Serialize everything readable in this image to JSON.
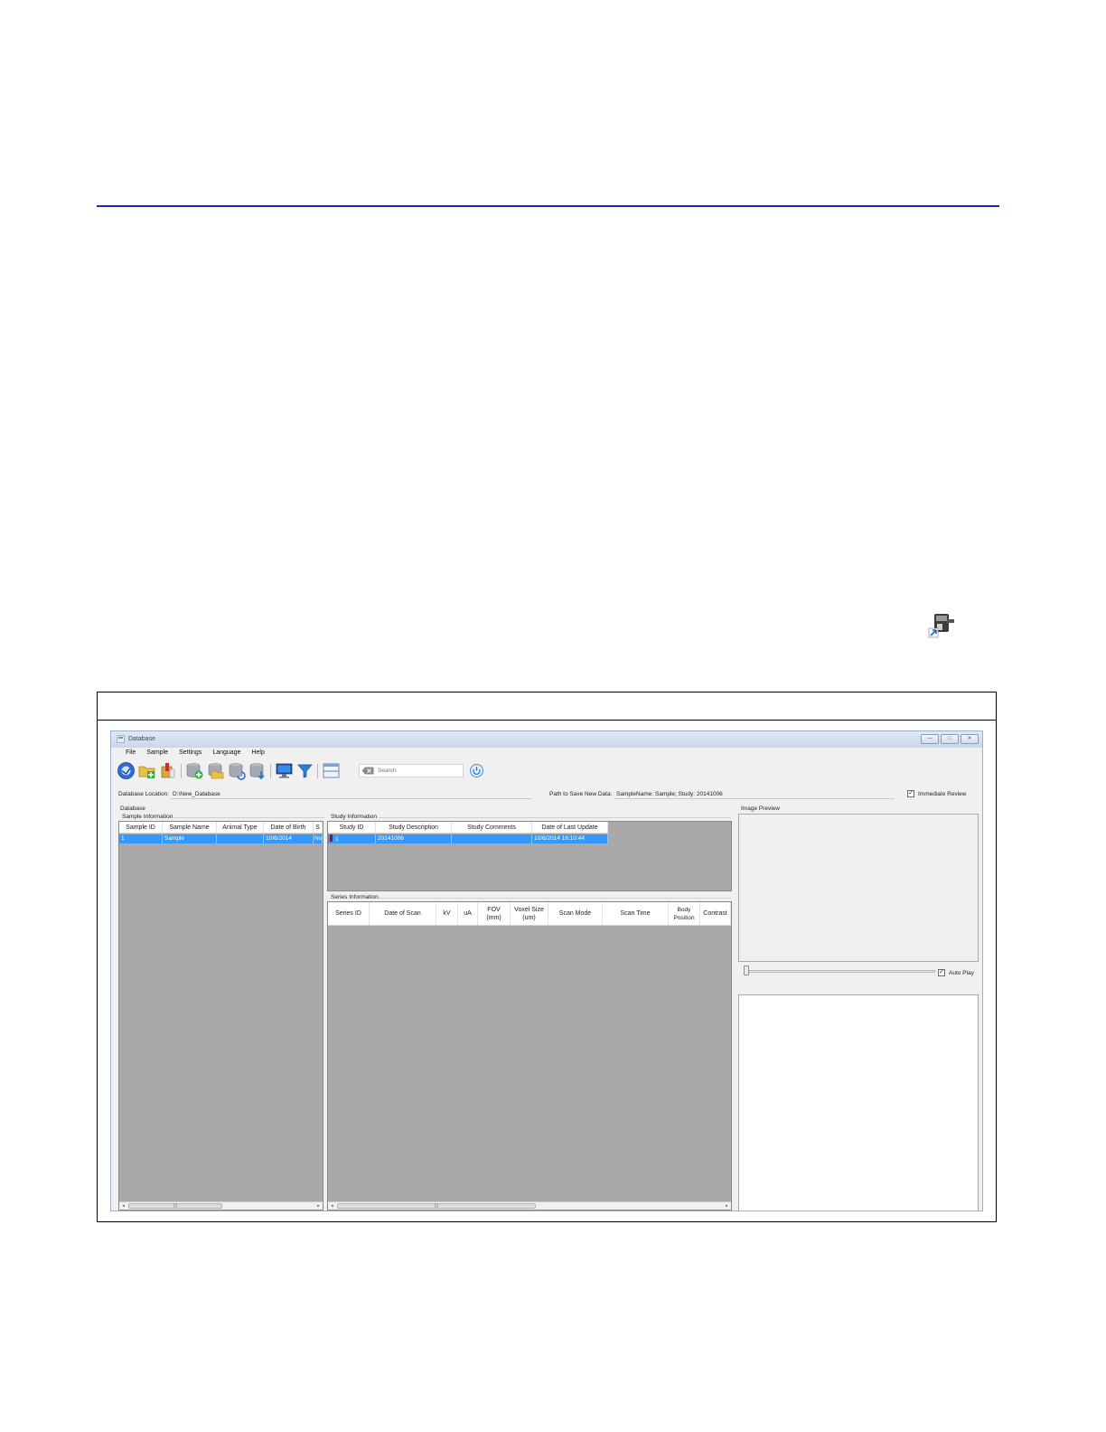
{
  "window": {
    "title": "Database",
    "minimize": "—",
    "maximize": "□",
    "close": "✕"
  },
  "menu": [
    "File",
    "Sample",
    "Settings",
    "Language",
    "Help"
  ],
  "toolbar": {
    "search_placeholder": "Search"
  },
  "location": {
    "db_label": "Database Location:",
    "db_value": "D:\\New_Database",
    "path_label": "Path to Save New Data:",
    "path_value": "SampleName: Sample; Study: 20141006",
    "immediate_review_label": "Immediate Review",
    "immediate_review_checked": true
  },
  "database_group": "Database",
  "sample": {
    "group": "Sample Information",
    "columns": [
      "Sample ID",
      "Sample Name",
      "Animal Type",
      "Date of Birth",
      "S"
    ],
    "rows": [
      [
        "1",
        "Sample",
        "",
        "10/6/2014",
        "No"
      ]
    ]
  },
  "study": {
    "group": "Study Information",
    "columns": [
      "Study ID",
      "Study Description",
      "Study Comments",
      "Date of Last Update"
    ],
    "rows": [
      [
        "1",
        "20141006",
        "",
        "10/6/2014 16:10:44"
      ]
    ]
  },
  "series": {
    "group": "Series Information",
    "columns": [
      "Series ID",
      "Date of Scan",
      "kV",
      "uA",
      "FOV\n(mm)",
      "Voxel Size\n(um)",
      "Scan Mode",
      "Scan Time",
      "Body\nPosition",
      "Contrast"
    ]
  },
  "preview": {
    "group": "Image Preview",
    "auto_play_label": "Auto Play",
    "auto_play_checked": true,
    "slider_fraction": 0.0
  },
  "scroll": {
    "left_arrow": "◂",
    "right_arrow": "▸",
    "grip": "|||"
  },
  "colors": {
    "selection": "#3399ff",
    "grid_background": "#a9a9a9",
    "rule": "#2323b8"
  }
}
